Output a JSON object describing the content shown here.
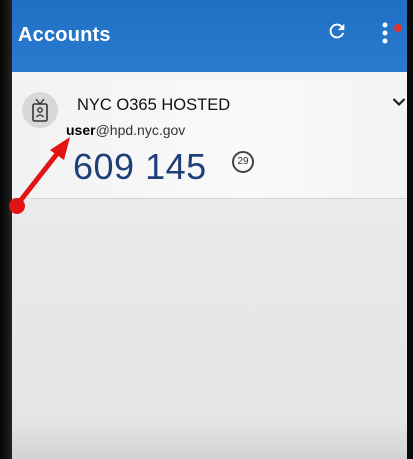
{
  "app_bar": {
    "title": "Accounts",
    "refresh_icon": "refresh-icon",
    "more_icon": "more-vertical-icon",
    "accent_color": "#2a7bd0"
  },
  "account": {
    "name": "NYC O365 HOSTED",
    "email_user": "user",
    "email_domain": "@hpd.nyc.gov",
    "otp_code": "609 145",
    "timer_seconds": "29",
    "avatar_icon": "badge-icon",
    "expand_icon": "chevron-down-icon"
  },
  "annotation": {
    "arrow_color": "#e01414"
  }
}
